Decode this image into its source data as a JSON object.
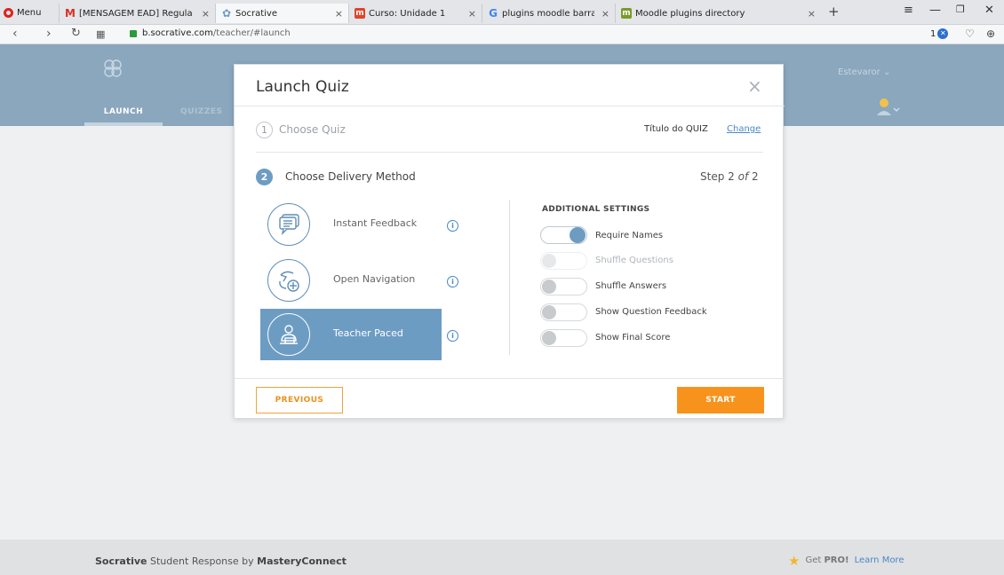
{
  "browser": {
    "menu_label": "Menu",
    "tabs": [
      {
        "title": "[MENSAGEM EAD] Regula",
        "favicon": "gmail-icon",
        "active": false
      },
      {
        "title": "Socrative",
        "favicon": "socrative-icon",
        "active": true
      },
      {
        "title": "Curso: Unidade 1",
        "favicon": "moodle-icon",
        "active": false
      },
      {
        "title": "plugins moodle barra de p",
        "favicon": "google-icon",
        "active": false
      },
      {
        "title": "Moodle plugins directory",
        "favicon": "moodle-icon",
        "active": false
      }
    ],
    "new_tab": "+",
    "url_host": "b.socrative.com",
    "url_path": "/teacher/#launch",
    "badge_count": "1"
  },
  "app": {
    "nav": {
      "launch": "LAUNCH",
      "quizzes": "QUIZZES"
    },
    "user_name": "Estevaror",
    "accent_color": "#8aa7be"
  },
  "modal": {
    "title": "Launch Quiz",
    "close_glyph": "×",
    "step1": {
      "number": "1",
      "label": "Choose Quiz",
      "quiz_name": "Título do QUIZ",
      "change_label": "Change"
    },
    "step2": {
      "number": "2",
      "label": "Choose Delivery Method",
      "counter_prefix": "Step 2",
      "counter_of": "of",
      "counter_total": "2"
    },
    "methods": [
      {
        "label": "Instant Feedback",
        "icon": "chat-bubbles-icon",
        "selected": false
      },
      {
        "label": "Open Navigation",
        "icon": "navigation-compass-icon",
        "selected": false
      },
      {
        "label": "Teacher Paced",
        "icon": "teacher-icon",
        "selected": true
      }
    ],
    "info_glyph": "i",
    "additional_settings_title": "ADDITIONAL SETTINGS",
    "settings": [
      {
        "label": "Require Names",
        "on": true,
        "disabled": false
      },
      {
        "label": "Shuffle Questions",
        "on": false,
        "disabled": true
      },
      {
        "label": "Shuffle Answers",
        "on": false,
        "disabled": false
      },
      {
        "label": "Show Question Feedback",
        "on": false,
        "disabled": false
      },
      {
        "label": "Show Final Score",
        "on": false,
        "disabled": false
      }
    ],
    "previous_label": "PREVIOUS",
    "start_label": "START",
    "start_color": "#f7931d"
  },
  "footer": {
    "brand": "Socrative",
    "tagline": "Student Response by",
    "company": "MasteryConnect",
    "get_pro": "Get",
    "pro": "PRO!",
    "learn_more": "Learn More"
  }
}
